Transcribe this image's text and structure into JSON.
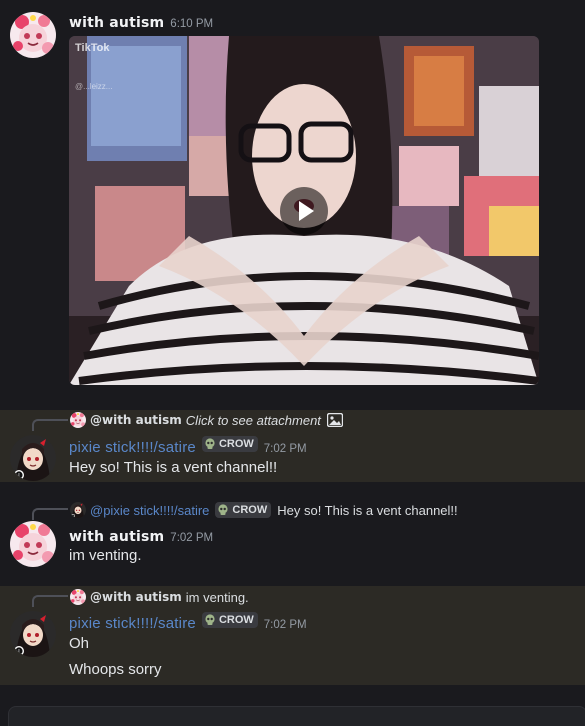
{
  "messages": [
    {
      "author": "with autism",
      "timestamp": "6:10 PM",
      "attachment": {
        "type": "video",
        "watermark": "TikTok",
        "handle": "@...leizz..."
      }
    },
    {
      "reply_to": {
        "author": "@with autism",
        "text": "Click to see attachment",
        "icon": "image-icon"
      },
      "author": "pixie stick!!!!/satire",
      "tag": "CROW",
      "tag_icon": "skull-icon",
      "timestamp": "7:02 PM",
      "lines": [
        "Hey so! This is a vent channel!!"
      ],
      "highlighted": true
    },
    {
      "reply_to": {
        "author": "@pixie stick!!!!/satire",
        "tag": "CROW",
        "text": "Hey so! This is a vent channel!!"
      },
      "author": "with autism",
      "timestamp": "7:02 PM",
      "lines": [
        "im venting."
      ],
      "highlighted": false
    },
    {
      "reply_to": {
        "author": "@with autism",
        "text": "im venting."
      },
      "author": "pixie stick!!!!/satire",
      "tag": "CROW",
      "tag_icon": "skull-icon",
      "timestamp": "7:02 PM",
      "lines": [
        "Oh",
        "Whoops sorry"
      ],
      "highlighted": true
    }
  ],
  "colors": {
    "background": "#1a1a1e",
    "highlight": "#2c2a25",
    "username_blue": "#5a87c9",
    "timestamp": "#949ba4"
  }
}
